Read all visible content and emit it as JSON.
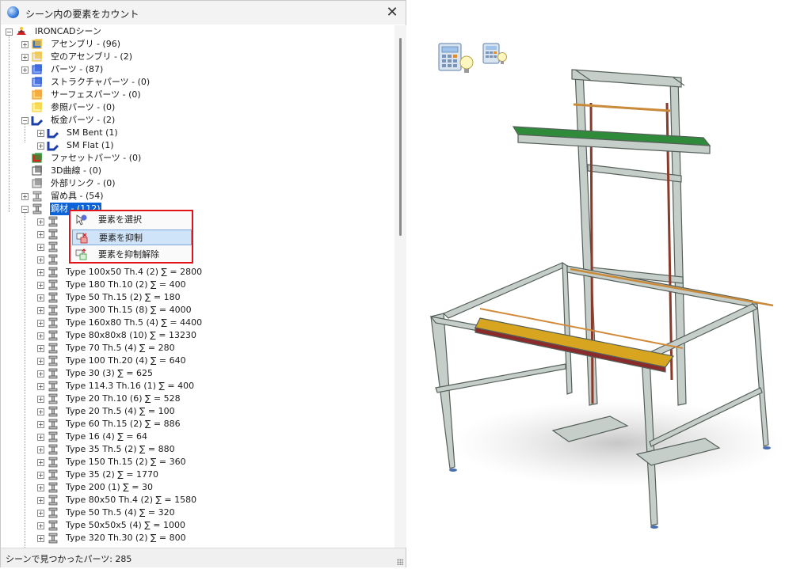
{
  "window": {
    "title": "シーン内の要素をカウント"
  },
  "tree": {
    "root": "IRONCADシーン",
    "nodes": [
      {
        "label": "アセンブリ - (96)",
        "icon": "assembly-icon"
      },
      {
        "label": "空のアセンブリ - (2)",
        "icon": "empty-assembly-icon"
      },
      {
        "label": "パーツ - (87)",
        "icon": "part-icon"
      },
      {
        "label": "ストラクチャパーツ - (0)",
        "icon": "structure-part-icon"
      },
      {
        "label": "サーフェスパーツ - (0)",
        "icon": "surface-part-icon"
      },
      {
        "label": "参照パーツ - (0)",
        "icon": "reference-part-icon"
      },
      {
        "label": "板金パーツ - (2)",
        "icon": "sheet-metal-icon"
      },
      {
        "label": "SM Bent (1)",
        "icon": "sheet-metal-icon"
      },
      {
        "label": "SM Flat (1)",
        "icon": "sheet-metal-icon"
      },
      {
        "label": "ファセットパーツ - (0)",
        "icon": "facet-part-icon"
      },
      {
        "label": "3D曲線 - (0)",
        "icon": "curve-3d-icon"
      },
      {
        "label": "外部リンク - (0)",
        "icon": "external-link-icon"
      },
      {
        "label": "留め具 - (54)",
        "icon": "fastener-icon"
      },
      {
        "label": "鋼材 - (112)",
        "icon": "steel-beam-icon"
      }
    ],
    "steel_items": [
      "Type 100x50 Th.4 (2) ∑ = 2800",
      "Type 180 Th.10 (2) ∑ = 400",
      "Type 50 Th.15 (2) ∑ = 180",
      "Type 300 Th.15 (8) ∑ = 4000",
      "Type 160x80 Th.5 (4) ∑ = 4400",
      "Type 80x80x8 (10) ∑ = 13230",
      "Type 70 Th.5 (4) ∑ = 280",
      "Type 100 Th.20 (4) ∑ = 640",
      "Type 30 (3) ∑ = 625",
      "Type 114.3 Th.16 (1) ∑ = 400",
      "Type 20 Th.10 (6) ∑ = 528",
      "Type 20 Th.5 (4) ∑ = 100",
      "Type 60 Th.15 (2) ∑ = 886",
      "Type 16 (4) ∑ = 64",
      "Type 35 Th.5 (2) ∑ = 880",
      "Type 150 Th.15 (2) ∑ = 360",
      "Type 35 (2) ∑ = 1770",
      "Type 200 (1) ∑ = 30",
      "Type 80x50 Th.4 (2) ∑ = 1580",
      "Type 50 Th.5 (4) ∑ = 320",
      "Type 50x50x5 (4) ∑ = 1000",
      "Type 320 Th.30 (2) ∑ = 800"
    ]
  },
  "context_menu": {
    "select": "要素を選択",
    "suppress": "要素を抑制",
    "unsuppress": "要素を抑制解除"
  },
  "status": {
    "text": "シーンで見つかったパーツ: 285"
  },
  "colors": {
    "selection": "#0b63d8",
    "menu_border": "#e0141a",
    "menu_highlight": "#cfe4f9"
  }
}
